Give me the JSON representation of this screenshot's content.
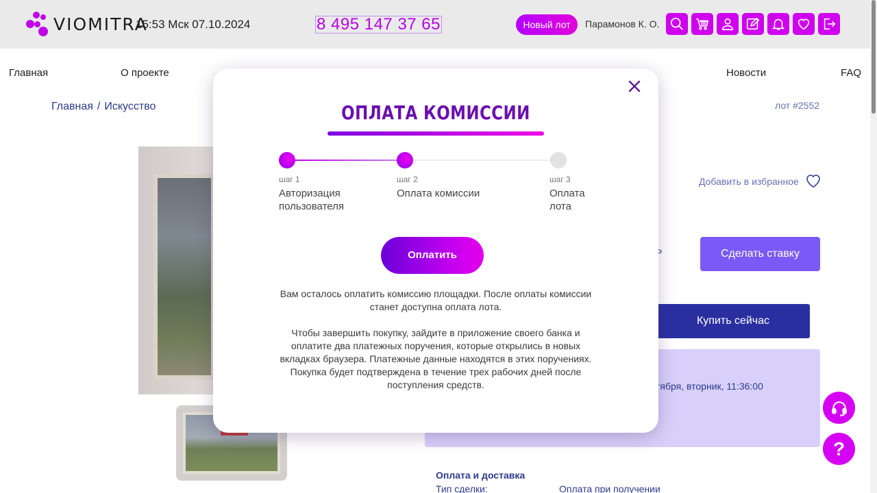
{
  "header": {
    "logo_text": "VIOMITRA",
    "clock": "15:53 Мск 07.10.2024",
    "phone": "8 495 147 37 65",
    "new_lot_label": "Новый лот",
    "user_name": "Парамонов К. О.",
    "icons": [
      "search-icon",
      "cart-icon",
      "user-icon",
      "edit-icon",
      "bell-icon",
      "heart-icon",
      "logout-icon"
    ]
  },
  "nav": {
    "items": [
      "Главная",
      "О проекте",
      "Новости",
      "FAQ"
    ]
  },
  "breadcrumb": {
    "items": [
      "Главная",
      "Искусство"
    ],
    "separator": "/"
  },
  "lot": {
    "number": "лот #2552",
    "favorite_label": "Добавить в избранное",
    "bid_button": "Сделать ставку",
    "buy_button": "Купить сейчас",
    "partial_char": "Р",
    "date_partial": "тября, вторник, 11:36:00",
    "payment_delivery_title": "Оплата и доставка",
    "deal_type_label": "Тип сделки:",
    "deal_type_value": "Оплата при получении"
  },
  "modal": {
    "title": "ОПЛАТА КОМИССИИ",
    "steps": [
      {
        "num": "шаг 1",
        "label_line1": "Авторизация",
        "label_line2": "пользователя",
        "state": "done"
      },
      {
        "num": "шаг 2",
        "label_line1": "Оплата комиссии",
        "label_line2": "",
        "state": "done"
      },
      {
        "num": "шаг 3",
        "label_line1": "Оплата",
        "label_line2": "лота",
        "state": "todo"
      }
    ],
    "pay_button": "Оплатить",
    "text1_line1": "Вам осталось оплатить комиссию площадки. После оплаты комиссии",
    "text1_line2": "станет доступна оплата лота.",
    "text2_line1": "Чтобы завершить покупку, зайдите в приложение своего банка и",
    "text2_line2": "оплатите два платежных поручения, которые открылись в новых",
    "text2_line3": "вкладках браузера. Платежные данные находятся в этих поручениях.",
    "text2_line4": "Покупка будет подтверждена в течение трех рабочих дней после",
    "text2_line5": "поступления средств."
  },
  "floating": {
    "support_icon": "headset-icon",
    "help_label": "?"
  },
  "colors": {
    "brand_magenta": "#cf00ee",
    "title_purple": "#6a0fb0",
    "bid_violet": "#7a5af7",
    "buy_navy": "#2a2fa0",
    "panel_lavender": "#d8d0fb"
  }
}
